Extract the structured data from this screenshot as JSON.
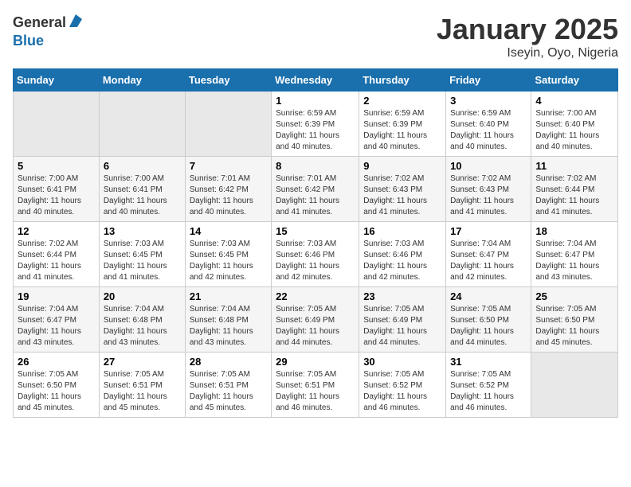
{
  "header": {
    "logo_general": "General",
    "logo_blue": "Blue",
    "month_title": "January 2025",
    "subtitle": "Iseyin, Oyo, Nigeria"
  },
  "days_of_week": [
    "Sunday",
    "Monday",
    "Tuesday",
    "Wednesday",
    "Thursday",
    "Friday",
    "Saturday"
  ],
  "weeks": [
    [
      {
        "day": "",
        "info": ""
      },
      {
        "day": "",
        "info": ""
      },
      {
        "day": "",
        "info": ""
      },
      {
        "day": "1",
        "info": "Sunrise: 6:59 AM\nSunset: 6:39 PM\nDaylight: 11 hours and 40 minutes."
      },
      {
        "day": "2",
        "info": "Sunrise: 6:59 AM\nSunset: 6:39 PM\nDaylight: 11 hours and 40 minutes."
      },
      {
        "day": "3",
        "info": "Sunrise: 6:59 AM\nSunset: 6:40 PM\nDaylight: 11 hours and 40 minutes."
      },
      {
        "day": "4",
        "info": "Sunrise: 7:00 AM\nSunset: 6:40 PM\nDaylight: 11 hours and 40 minutes."
      }
    ],
    [
      {
        "day": "5",
        "info": "Sunrise: 7:00 AM\nSunset: 6:41 PM\nDaylight: 11 hours and 40 minutes."
      },
      {
        "day": "6",
        "info": "Sunrise: 7:00 AM\nSunset: 6:41 PM\nDaylight: 11 hours and 40 minutes."
      },
      {
        "day": "7",
        "info": "Sunrise: 7:01 AM\nSunset: 6:42 PM\nDaylight: 11 hours and 40 minutes."
      },
      {
        "day": "8",
        "info": "Sunrise: 7:01 AM\nSunset: 6:42 PM\nDaylight: 11 hours and 41 minutes."
      },
      {
        "day": "9",
        "info": "Sunrise: 7:02 AM\nSunset: 6:43 PM\nDaylight: 11 hours and 41 minutes."
      },
      {
        "day": "10",
        "info": "Sunrise: 7:02 AM\nSunset: 6:43 PM\nDaylight: 11 hours and 41 minutes."
      },
      {
        "day": "11",
        "info": "Sunrise: 7:02 AM\nSunset: 6:44 PM\nDaylight: 11 hours and 41 minutes."
      }
    ],
    [
      {
        "day": "12",
        "info": "Sunrise: 7:02 AM\nSunset: 6:44 PM\nDaylight: 11 hours and 41 minutes."
      },
      {
        "day": "13",
        "info": "Sunrise: 7:03 AM\nSunset: 6:45 PM\nDaylight: 11 hours and 41 minutes."
      },
      {
        "day": "14",
        "info": "Sunrise: 7:03 AM\nSunset: 6:45 PM\nDaylight: 11 hours and 42 minutes."
      },
      {
        "day": "15",
        "info": "Sunrise: 7:03 AM\nSunset: 6:46 PM\nDaylight: 11 hours and 42 minutes."
      },
      {
        "day": "16",
        "info": "Sunrise: 7:03 AM\nSunset: 6:46 PM\nDaylight: 11 hours and 42 minutes."
      },
      {
        "day": "17",
        "info": "Sunrise: 7:04 AM\nSunset: 6:47 PM\nDaylight: 11 hours and 42 minutes."
      },
      {
        "day": "18",
        "info": "Sunrise: 7:04 AM\nSunset: 6:47 PM\nDaylight: 11 hours and 43 minutes."
      }
    ],
    [
      {
        "day": "19",
        "info": "Sunrise: 7:04 AM\nSunset: 6:47 PM\nDaylight: 11 hours and 43 minutes."
      },
      {
        "day": "20",
        "info": "Sunrise: 7:04 AM\nSunset: 6:48 PM\nDaylight: 11 hours and 43 minutes."
      },
      {
        "day": "21",
        "info": "Sunrise: 7:04 AM\nSunset: 6:48 PM\nDaylight: 11 hours and 43 minutes."
      },
      {
        "day": "22",
        "info": "Sunrise: 7:05 AM\nSunset: 6:49 PM\nDaylight: 11 hours and 44 minutes."
      },
      {
        "day": "23",
        "info": "Sunrise: 7:05 AM\nSunset: 6:49 PM\nDaylight: 11 hours and 44 minutes."
      },
      {
        "day": "24",
        "info": "Sunrise: 7:05 AM\nSunset: 6:50 PM\nDaylight: 11 hours and 44 minutes."
      },
      {
        "day": "25",
        "info": "Sunrise: 7:05 AM\nSunset: 6:50 PM\nDaylight: 11 hours and 45 minutes."
      }
    ],
    [
      {
        "day": "26",
        "info": "Sunrise: 7:05 AM\nSunset: 6:50 PM\nDaylight: 11 hours and 45 minutes."
      },
      {
        "day": "27",
        "info": "Sunrise: 7:05 AM\nSunset: 6:51 PM\nDaylight: 11 hours and 45 minutes."
      },
      {
        "day": "28",
        "info": "Sunrise: 7:05 AM\nSunset: 6:51 PM\nDaylight: 11 hours and 45 minutes."
      },
      {
        "day": "29",
        "info": "Sunrise: 7:05 AM\nSunset: 6:51 PM\nDaylight: 11 hours and 46 minutes."
      },
      {
        "day": "30",
        "info": "Sunrise: 7:05 AM\nSunset: 6:52 PM\nDaylight: 11 hours and 46 minutes."
      },
      {
        "day": "31",
        "info": "Sunrise: 7:05 AM\nSunset: 6:52 PM\nDaylight: 11 hours and 46 minutes."
      },
      {
        "day": "",
        "info": ""
      }
    ]
  ]
}
